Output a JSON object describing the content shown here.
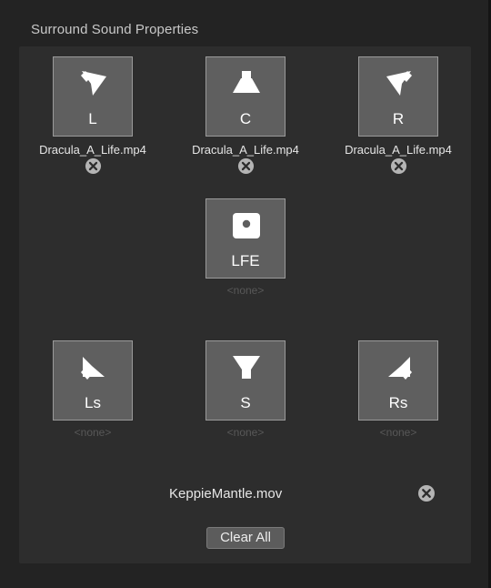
{
  "panel": {
    "title": "Surround Sound Properties"
  },
  "channels": {
    "l": {
      "label": "L",
      "assignment": "Dracula_A_Life.mp4",
      "icon": "speaker-front-left-icon"
    },
    "c": {
      "label": "C",
      "assignment": "Dracula_A_Life.mp4",
      "icon": "speaker-center-icon"
    },
    "r": {
      "label": "R",
      "assignment": "Dracula_A_Life.mp4",
      "icon": "speaker-front-right-icon"
    },
    "lfe": {
      "label": "LFE",
      "assignment": "<none>",
      "icon": "subwoofer-icon"
    },
    "ls": {
      "label": "Ls",
      "assignment": "<none>",
      "icon": "speaker-left-surround-icon"
    },
    "s": {
      "label": "S",
      "assignment": "<none>",
      "icon": "speaker-surround-icon"
    },
    "rs": {
      "label": "Rs",
      "assignment": "<none>",
      "icon": "speaker-right-surround-icon"
    }
  },
  "source": {
    "file": "KeppieMantle.mov"
  },
  "buttons": {
    "clear_all": "Clear All"
  },
  "colors": {
    "background": "#232323",
    "panel": "#2d2d2d",
    "tile": "#5f5f5f",
    "tile_border": "#9a9a9a",
    "none_text": "#585858"
  }
}
